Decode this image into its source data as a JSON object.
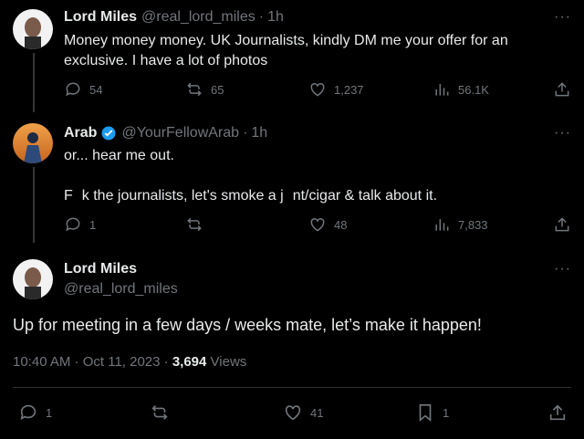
{
  "tweets": [
    {
      "name": "Lord Miles",
      "handle": "@real_lord_miles",
      "time": "1h",
      "text_line1": "Money money money. UK Journalists, kindly DM me your offer for an",
      "text_line2": "exclusive. I have a lot of photos",
      "replies": "54",
      "retweets": "65",
      "likes": "1,237",
      "views": "56.1K"
    },
    {
      "name": "Arab",
      "handle": "@YourFellowArab",
      "time": "1h",
      "text_line1": "or... hear me out.",
      "text_line2a": "F",
      "text_line2b": "k the journalists, let's smoke a j",
      "text_line2c": "nt/cigar & talk about it.",
      "replies": "1",
      "retweets": "",
      "likes": "48",
      "views": "7,833"
    }
  ],
  "main_tweet": {
    "name": "Lord Miles",
    "handle": "@real_lord_miles",
    "text": "Up for meeting in a few days / weeks mate, let’s make it happen!",
    "timestamp": "10:40 AM · Oct 11, 2023 · ",
    "views_count": "3,694",
    "views_label": " Views",
    "replies": "1",
    "retweets": "",
    "likes": "41",
    "bookmarks": "1"
  },
  "more_glyph": "···",
  "dot": "·",
  "colors": {
    "background": "#000000",
    "text": "#e7e9ea",
    "muted": "#71767b",
    "verified": "#1d9bf0"
  }
}
